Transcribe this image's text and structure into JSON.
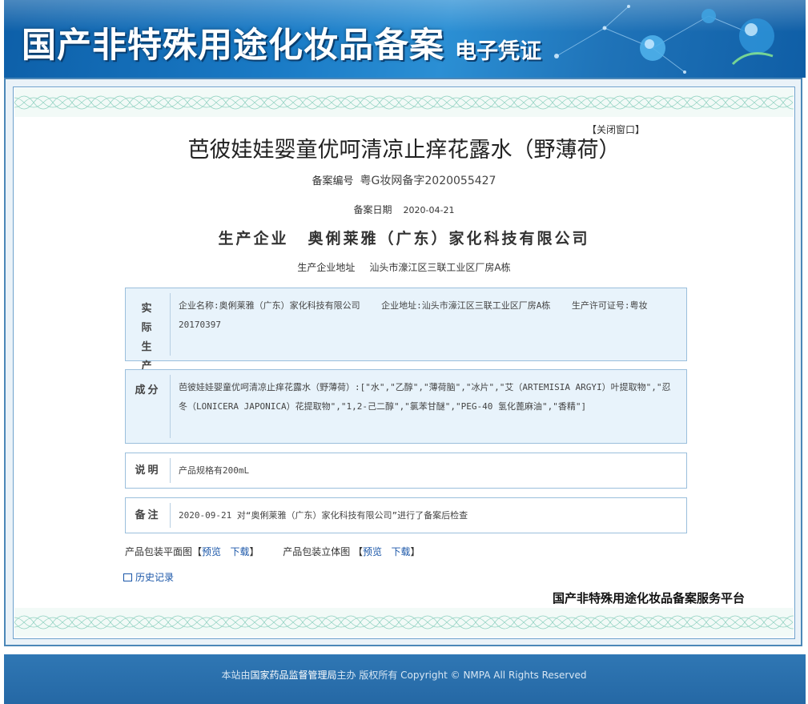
{
  "banner": {
    "title": "国产非特殊用途化妆品备案",
    "subtitle": "电子凭证"
  },
  "close_window": "【关闭窗口】",
  "product_name": "芭彼娃娃婴童优呵清凉止痒花露水（野薄荷）",
  "registration": {
    "label": "备案编号",
    "value": "粤G妆网备字2020055427"
  },
  "record_date": {
    "label": "备案日期",
    "value": "2020-04-21"
  },
  "producer": {
    "label": "生产企业",
    "value": "奥俐莱雅（广东）家化科技有限公司"
  },
  "producer_address": {
    "label": "生产企业地址",
    "value": "汕头市濠江区三联工业区厂房A栋"
  },
  "sections": {
    "actual_producer": {
      "label": "实际生产企业",
      "text": "企业名称:奥俐莱雅（广东）家化科技有限公司    企业地址:汕头市濠江区三联工业区厂房A栋    生产许可证号:粤妆20170397"
    },
    "ingredients": {
      "label": "成分",
      "text": "芭彼娃娃婴童优呵清凉止痒花露水（野薄荷）:[\"水\",\"乙醇\",\"薄荷脑\",\"冰片\",\"艾（ARTEMISIA ARGYI）叶提取物\",\"忍冬（LONICERA JAPONICA）花提取物\",\"1,2-己二醇\",\"氯苯甘醚\",\"PEG-40 氢化蓖麻油\",\"香精\"]"
    },
    "description": {
      "label": "说明",
      "text": "产品规格有200mL"
    },
    "remarks": {
      "label": "备注",
      "text": "2020-09-21 对“奥俐莱雅（广东）家化科技有限公司”进行了备案后检查"
    }
  },
  "packaging": {
    "flat_label": "产品包装平面图",
    "three_d_label": "产品包装立体图",
    "preview": "预览",
    "download": "下载",
    "bracket_open": "【",
    "bracket_close": "】"
  },
  "history_link": "历史记录",
  "platform_name": "国产非特殊用途化妆品备案服务平台",
  "footer": {
    "prefix": "本站由",
    "org": "国家药品监督管理局",
    "suffix": "主办 版权所有 Copyright © NMPA All Rights Reserved"
  },
  "colors": {
    "banner_blue": "#1a7bc6",
    "frame_border": "#4b87b8",
    "box_blue_bg": "#e8f3fb",
    "link_blue": "#1a56a8",
    "footer_blue": "#2f77b4"
  }
}
